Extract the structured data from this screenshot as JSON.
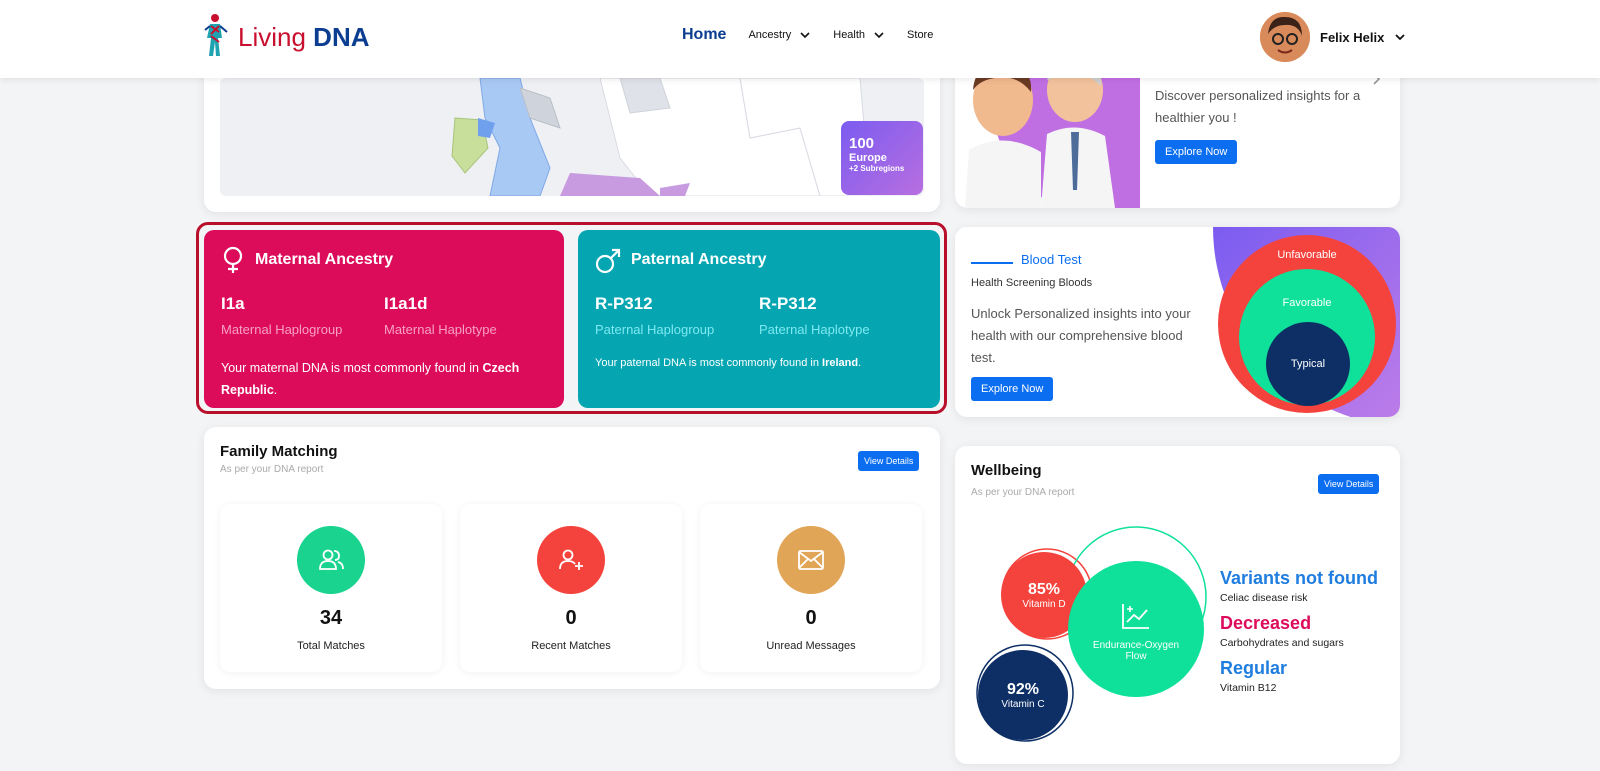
{
  "header": {
    "logo_living": "Living",
    "logo_dna": "DNA",
    "nav": {
      "home": "Home",
      "ancestry": "Ancestry",
      "health": "Health",
      "store": "Store"
    },
    "user_name": "Felix Helix"
  },
  "map": {
    "badge_number": "100",
    "badge_region": "Europe",
    "badge_subregions": "+2 Subregions"
  },
  "promo": {
    "text": "Discover personalized insights for a healthier you !",
    "button": "Explore Now"
  },
  "maternal": {
    "title": "Maternal Ancestry",
    "haplogroup_value": "I1a",
    "haplogroup_label": "Maternal Haplogroup",
    "haplotype_value": "I1a1d",
    "haplotype_label": "Maternal Haplotype",
    "found_prefix": "Your maternal DNA is most commonly found in",
    "found_place": "Czech Republic",
    "found_suffix": "."
  },
  "paternal": {
    "title": "Paternal Ancestry",
    "haplogroup_value": "R-P312",
    "haplogroup_label": "Paternal Haplogroup",
    "haplotype_value": "R-P312",
    "haplotype_label": "Paternal Haplotype",
    "found_prefix": "Your paternal DNA is most commonly found in",
    "found_place": "Ireland",
    "found_suffix": "."
  },
  "blood_test": {
    "title": "Blood Test",
    "subtitle": "Health Screening Bloods",
    "description": "Unlock Personalized insights into your health with our comprehensive blood test.",
    "button": "Explore Now",
    "rings": {
      "outer": "Unfavorable",
      "middle": "Favorable",
      "inner": "Typical"
    }
  },
  "family": {
    "title": "Family Matching",
    "subtitle": "As per your DNA report",
    "button": "View Details",
    "stats": [
      {
        "value": "34",
        "label": "Total Matches",
        "color": "#19d38f",
        "icon": "people-icon"
      },
      {
        "value": "0",
        "label": "Recent Matches",
        "color": "#f4433c",
        "icon": "add-user-icon"
      },
      {
        "value": "0",
        "label": "Unread Messages",
        "color": "#e0a556",
        "icon": "envelope-icon"
      }
    ]
  },
  "wellbeing": {
    "title": "Wellbeing",
    "subtitle": "As per your DNA report",
    "button": "View Details",
    "bubbles": [
      {
        "value": "85%",
        "label": "Vitamin D",
        "color": "#f4433c"
      },
      {
        "value": "",
        "label": "Endurance-Oxygen Flow",
        "color": "#0fe09a"
      },
      {
        "value": "92%",
        "label": "Vitamin C",
        "color": "#0d2f66"
      }
    ],
    "variants": [
      {
        "status": "Variants not found",
        "trait": "Celiac disease risk",
        "color": "#1f7de0"
      },
      {
        "status": "Decreased",
        "trait": "Carbohydrates and sugars",
        "color": "#dc0c5b"
      },
      {
        "status": "Regular",
        "trait": "Vitamin B12",
        "color": "#1f7de0"
      }
    ]
  }
}
